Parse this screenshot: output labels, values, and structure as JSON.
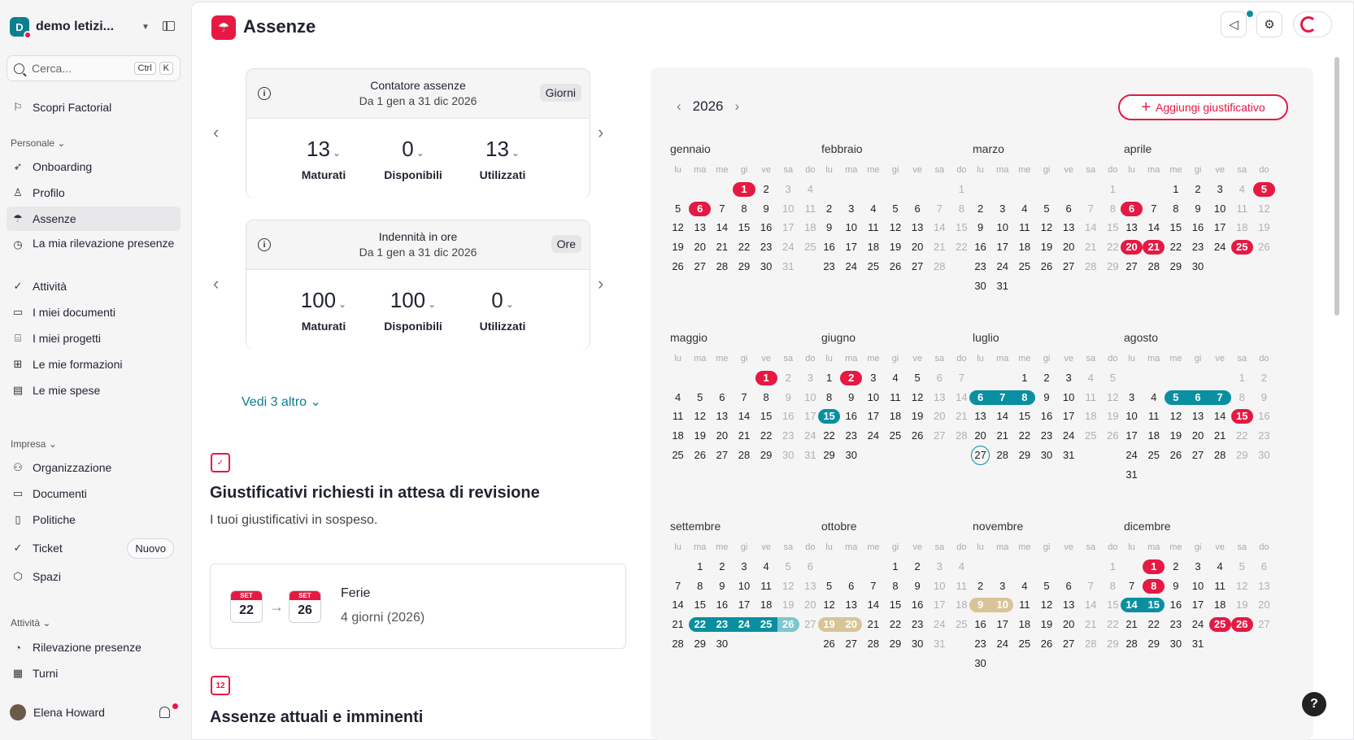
{
  "sidebar": {
    "company": "demo letizi...",
    "logo_letter": "D",
    "search": {
      "placeholder": "Cerca...",
      "kbd1": "Ctrl",
      "kbd2": "K"
    },
    "discover": "Scopri Factorial",
    "personal_label": "Personale",
    "company_label": "Impresa",
    "activity_label": "Attività",
    "items": [
      {
        "label": "Onboarding",
        "icon": "rocket-icon"
      },
      {
        "label": "Profilo",
        "icon": "user-icon"
      },
      {
        "label": "Assenze",
        "icon": "umbrella-icon"
      },
      {
        "label": "La mia rilevazione presenze",
        "icon": "clock-icon"
      },
      {
        "label": "Attività",
        "icon": "check-circle-icon"
      },
      {
        "label": "I miei documenti",
        "icon": "folder-icon"
      },
      {
        "label": "I miei progetti",
        "icon": "briefcase-icon"
      },
      {
        "label": "Le mie formazioni",
        "icon": "book-icon"
      },
      {
        "label": "Le mie spese",
        "icon": "wallet-icon"
      }
    ],
    "company_items": [
      {
        "label": "Organizzazione",
        "icon": "people-icon"
      },
      {
        "label": "Documenti",
        "icon": "folders-icon"
      },
      {
        "label": "Politiche",
        "icon": "document-icon"
      },
      {
        "label": "Ticket",
        "icon": "check-circle-icon",
        "badge": "Nuovo"
      },
      {
        "label": "Spazi",
        "icon": "cube-icon"
      }
    ],
    "activity_items": [
      {
        "label": "Rilevazione presenze",
        "icon": "stopwatch-icon"
      },
      {
        "label": "Turni",
        "icon": "calendar-clock-icon"
      }
    ],
    "user": "Elena Howard"
  },
  "page": {
    "title": "Assenze"
  },
  "counters": [
    {
      "title": "Contatore assenze",
      "range": "Da 1 gen a 31 dic 2026",
      "unit": "Giorni",
      "stats": [
        {
          "value": "13",
          "label": "Maturati"
        },
        {
          "value": "0",
          "label": "Disponibili"
        },
        {
          "value": "13",
          "label": "Utilizzati"
        }
      ]
    },
    {
      "title": "Indennità in ore",
      "range": "Da 1 gen a 31 dic 2026",
      "unit": "Ore",
      "stats": [
        {
          "value": "100",
          "label": "Maturati"
        },
        {
          "value": "100",
          "label": "Disponibili"
        },
        {
          "value": "0",
          "label": "Utilizzati"
        }
      ]
    }
  ],
  "see_more": "Vedi 3 altro",
  "pending": {
    "title": "Giustificativi richiesti in attesa di revisione",
    "subtitle": "I tuoi giustificativi in sospeso.",
    "request": {
      "start_month": "SET",
      "start_day": "22",
      "end_month": "SET",
      "end_day": "26",
      "type": "Ferie",
      "duration": "4 giorni (2026)"
    }
  },
  "current": {
    "title": "Assenze attuali e imminenti",
    "icon_day": "12"
  },
  "calendar": {
    "year": "2026",
    "add_button": "Aggiungi giustificativo",
    "weekdays": [
      "lu",
      "ma",
      "me",
      "gi",
      "ve",
      "sa",
      "do"
    ],
    "colors": {
      "holiday": "#e51943",
      "absence": "#0a8fa0",
      "pending": "#7fc6d0",
      "other": "#d8c497"
    },
    "months": [
      {
        "name": "gennaio",
        "offset": 3,
        "days": 31,
        "marks": {
          "1": "red",
          "6": "red"
        }
      },
      {
        "name": "febbraio",
        "offset": 6,
        "days": 28,
        "marks": {}
      },
      {
        "name": "marzo",
        "offset": 6,
        "days": 31,
        "marks": {}
      },
      {
        "name": "aprile",
        "offset": 2,
        "days": 30,
        "marks": {
          "5": "red",
          "6": "red",
          "20": "red",
          "21": "red",
          "25": "red"
        }
      },
      {
        "name": "maggio",
        "offset": 4,
        "days": 31,
        "marks": {
          "1": "red"
        }
      },
      {
        "name": "giugno",
        "offset": 0,
        "days": 30,
        "marks": {
          "2": "red",
          "15": "teal"
        }
      },
      {
        "name": "luglio",
        "offset": 2,
        "days": 31,
        "marks": {
          "6": "teal",
          "7": "teal",
          "8": "teal"
        },
        "today": 27
      },
      {
        "name": "agosto",
        "offset": 5,
        "days": 31,
        "marks": {
          "5": "teal",
          "6": "teal",
          "7": "teal",
          "15": "red"
        }
      },
      {
        "name": "settembre",
        "offset": 1,
        "days": 30,
        "marks": {
          "22": "teal",
          "23": "teal",
          "24": "teal",
          "25": "teal",
          "26": "lteal"
        }
      },
      {
        "name": "ottobre",
        "offset": 3,
        "days": 31,
        "marks": {
          "19": "tan",
          "20": "tan"
        }
      },
      {
        "name": "novembre",
        "offset": 6,
        "days": 30,
        "marks": {
          "9": "tan",
          "10": "tan"
        }
      },
      {
        "name": "dicembre",
        "offset": 1,
        "days": 31,
        "marks": {
          "1": "red",
          "8": "red",
          "14": "teal",
          "15": "teal",
          "25": "red",
          "26": "red"
        }
      }
    ]
  }
}
